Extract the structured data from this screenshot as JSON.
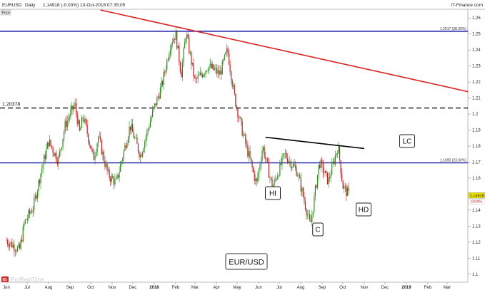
{
  "header": {
    "symbol": "EURUSD",
    "period": "Daily",
    "quote": "1.14918 (-0.03%)",
    "datetime": "10-Oct-2018 07:35:05",
    "source": "IT-Finance.com",
    "panel_tab": "Price"
  },
  "watermark": "ProRealTime",
  "colors": {
    "up_candle": "#2e8b1e",
    "down_candle": "#c02020",
    "trendline": "#e02020",
    "hline": "#1a1aaa",
    "neckline": "#000000",
    "price_tag": "#e8e000"
  },
  "chart_data": {
    "type": "candlestick",
    "title": "EUR/USD",
    "x_tick_labels": [
      "Jun",
      "Jul",
      "Aug",
      "Sep",
      "Oct",
      "Nov",
      "Dec",
      "2018",
      "Feb",
      "Mar",
      "Apr",
      "May",
      "Jun",
      "Jul",
      "Aug",
      "Sep",
      "Oct",
      "Nov",
      "Dec",
      "2019",
      "Feb",
      "Mar"
    ],
    "y_tick_labels": [
      "1.26",
      "1.25",
      "1.24",
      "1.23",
      "1.22",
      "1.21",
      "1.2",
      "1.19",
      "1.18",
      "1.17",
      "1.16",
      "1.15",
      "1.14",
      "1.13",
      "1.12",
      "1.11",
      "1.1"
    ],
    "ylim": [
      1.095,
      1.265
    ],
    "last_price": "1.14918",
    "last_change": "-0.04%",
    "horizontal_lines": [
      {
        "label": "1.2517 (38.20%)",
        "value": 1.2517,
        "style": "solid"
      },
      {
        "label": "1.1695 (23.60%)",
        "value": 1.1695,
        "style": "solid"
      },
      {
        "label": "1.20378",
        "value": 1.20378,
        "style": "dashed"
      }
    ],
    "annotations": [
      "LC",
      "HI",
      "C",
      "HD"
    ],
    "price_path": [
      [
        "2017-06-01",
        1.121
      ],
      [
        "2017-06-20",
        1.115
      ],
      [
        "2017-06-27",
        1.132
      ],
      [
        "2017-07-10",
        1.142
      ],
      [
        "2017-07-20",
        1.162
      ],
      [
        "2017-08-01",
        1.183
      ],
      [
        "2017-08-15",
        1.171
      ],
      [
        "2017-08-25",
        1.193
      ],
      [
        "2017-09-08",
        1.206
      ],
      [
        "2017-09-15",
        1.188
      ],
      [
        "2017-09-20",
        1.199
      ],
      [
        "2017-10-05",
        1.172
      ],
      [
        "2017-10-12",
        1.186
      ],
      [
        "2017-10-26",
        1.162
      ],
      [
        "2017-11-07",
        1.157
      ],
      [
        "2017-11-27",
        1.193
      ],
      [
        "2017-12-12",
        1.174
      ],
      [
        "2017-12-29",
        1.2
      ],
      [
        "2018-01-12",
        1.218
      ],
      [
        "2018-01-25",
        1.245
      ],
      [
        "2018-02-01",
        1.25
      ],
      [
        "2018-02-09",
        1.225
      ],
      [
        "2018-02-16",
        1.251
      ],
      [
        "2018-03-01",
        1.22
      ],
      [
        "2018-03-20",
        1.23
      ],
      [
        "2018-04-06",
        1.225
      ],
      [
        "2018-04-17",
        1.24
      ],
      [
        "2018-04-27",
        1.211
      ],
      [
        "2018-05-08",
        1.19
      ],
      [
        "2018-05-29",
        1.156
      ],
      [
        "2018-06-07",
        1.18
      ],
      [
        "2018-06-21",
        1.154
      ],
      [
        "2018-07-09",
        1.175
      ],
      [
        "2018-07-27",
        1.164
      ],
      [
        "2018-08-15",
        1.13
      ],
      [
        "2018-08-28",
        1.17
      ],
      [
        "2018-09-10",
        1.158
      ],
      [
        "2018-09-24",
        1.18
      ],
      [
        "2018-10-01",
        1.155
      ],
      [
        "2018-10-10",
        1.149
      ]
    ],
    "lc_line": {
      "from": [
        "2018-06-11",
        1.1855
      ],
      "to": [
        "2018-11-01",
        1.1785
      ]
    },
    "red_trendline": {
      "from": [
        "2017-10-15",
        1.265
      ],
      "to": [
        "2019-03-31",
        1.214
      ]
    }
  }
}
